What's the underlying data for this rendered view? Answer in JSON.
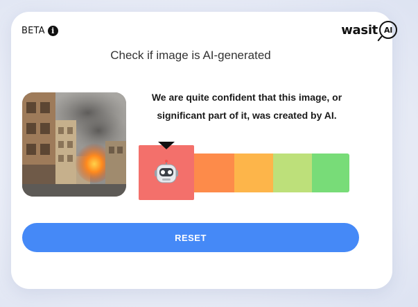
{
  "header": {
    "beta_label": "BETA",
    "info_icon": "info-icon",
    "logo": {
      "prefix": "was",
      "highlight": "it",
      "badge": "AI"
    }
  },
  "headline": "Check if image is AI-generated",
  "image": {
    "description_icon": "uploaded-image-thumbnail"
  },
  "result": {
    "line1": "We are quite confident that this image, or",
    "line2": "significant part of it, was created by AI."
  },
  "meter": {
    "selected_level": 1,
    "levels": 5,
    "colors": [
      "#f3706b",
      "#fd8b4a",
      "#fdb54a",
      "#bde07a",
      "#78dc78"
    ],
    "selected_icon": "robot-icon"
  },
  "actions": {
    "reset_label": "RESET"
  }
}
